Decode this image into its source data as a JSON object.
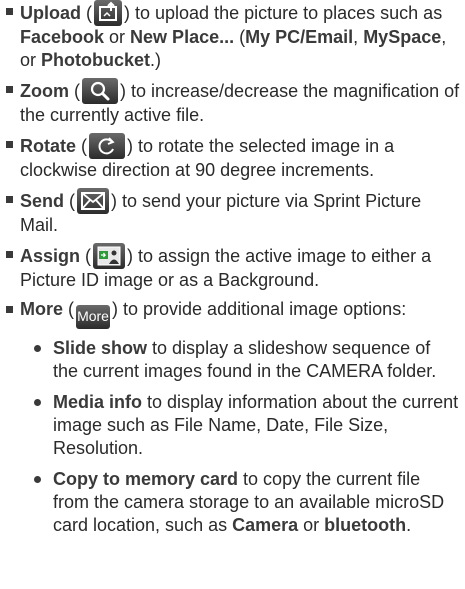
{
  "items": [
    {
      "title": "Upload",
      "icon": "upload-icon",
      "parts": [
        ") to upload the picture to places such as ",
        "Facebook",
        " or ",
        "New Place...",
        "(",
        "My PC/Email",
        ", ",
        "MySpace",
        ", or ",
        "Photobucket",
        ".)"
      ]
    },
    {
      "title": "Zoom",
      "icon": "zoom-icon",
      "text": ") to increase/decrease the magnification of the currently active file."
    },
    {
      "title": "Rotate",
      "icon": "rotate-icon",
      "text": ") to rotate the selected image in a clockwise direction at 90 degree increments."
    },
    {
      "title": "Send",
      "icon": "mail-icon",
      "text": ") to send your picture via Sprint Picture Mail."
    },
    {
      "title": "Assign",
      "icon": "assign-icon",
      "text": ") to assign the active image to either a Picture ID image or as a Background."
    },
    {
      "title": "More",
      "icon_label": "More",
      "text": ") to provide additional image options:"
    }
  ],
  "subitems": [
    {
      "title": "Slide show",
      "text": " to display a slideshow sequence of the current images found in the CAMERA folder."
    },
    {
      "title": "Media info",
      "text": " to display information about the current image such as File Name, Date, File Size, Resolution."
    },
    {
      "title": "Copy to memory card",
      "text": " to copy the current file from the camera storage to an available microSD card location, such as ",
      "bold1": "Camera",
      "mid": " or ",
      "bold2": "bluetooth",
      "end": "."
    }
  ],
  "open_paren": " ("
}
